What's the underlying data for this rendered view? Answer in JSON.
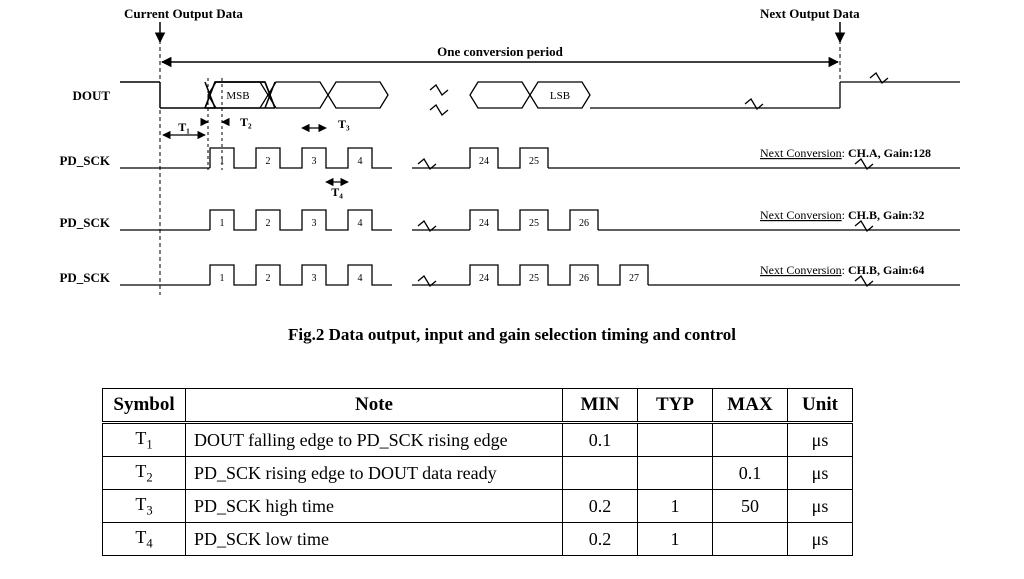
{
  "header_labels": {
    "current_output": "Current Output Data",
    "next_output": "Next Output Data",
    "one_period": "One conversion period"
  },
  "signals": {
    "dout": "DOUT",
    "pd_sck": "PD_SCK",
    "msb": "MSB",
    "lsb": "LSB"
  },
  "timing_labels": {
    "t1": "T₁",
    "t2": "T₂",
    "t3": "T₃",
    "t4": "T₄"
  },
  "pulse_numbers": {
    "row1": [
      "1",
      "2",
      "3",
      "4",
      "24",
      "25"
    ],
    "row2": [
      "1",
      "2",
      "3",
      "4",
      "24",
      "25",
      "26"
    ],
    "row3": [
      "1",
      "2",
      "3",
      "4",
      "24",
      "25",
      "26",
      "27"
    ]
  },
  "next_conv_label": "Next Conversion",
  "conversions": {
    "row1": "CH.A, Gain:128",
    "row2": "CH.B, Gain:32",
    "row3": "CH.B, Gain:64"
  },
  "caption": "Fig.2 Data output, input and gain selection timing and control",
  "table": {
    "headers": {
      "symbol": "Symbol",
      "note": "Note",
      "min": "MIN",
      "typ": "TYP",
      "max": "MAX",
      "unit": "Unit"
    },
    "rows": [
      {
        "symbol_main": "T",
        "symbol_sub": "1",
        "note": "DOUT falling edge to PD_SCK rising edge",
        "min": "0.1",
        "typ": "",
        "max": "",
        "unit": "μs"
      },
      {
        "symbol_main": "T",
        "symbol_sub": "2",
        "note": "PD_SCK rising edge to DOUT data ready",
        "min": "",
        "typ": "",
        "max": "0.1",
        "unit": "μs"
      },
      {
        "symbol_main": "T",
        "symbol_sub": "3",
        "note": "PD_SCK high time",
        "min": "0.2",
        "typ": "1",
        "max": "50",
        "unit": "μs"
      },
      {
        "symbol_main": "T",
        "symbol_sub": "4",
        "note": "PD_SCK low time",
        "min": "0.2",
        "typ": "1",
        "max": "",
        "unit": "μs"
      }
    ]
  }
}
